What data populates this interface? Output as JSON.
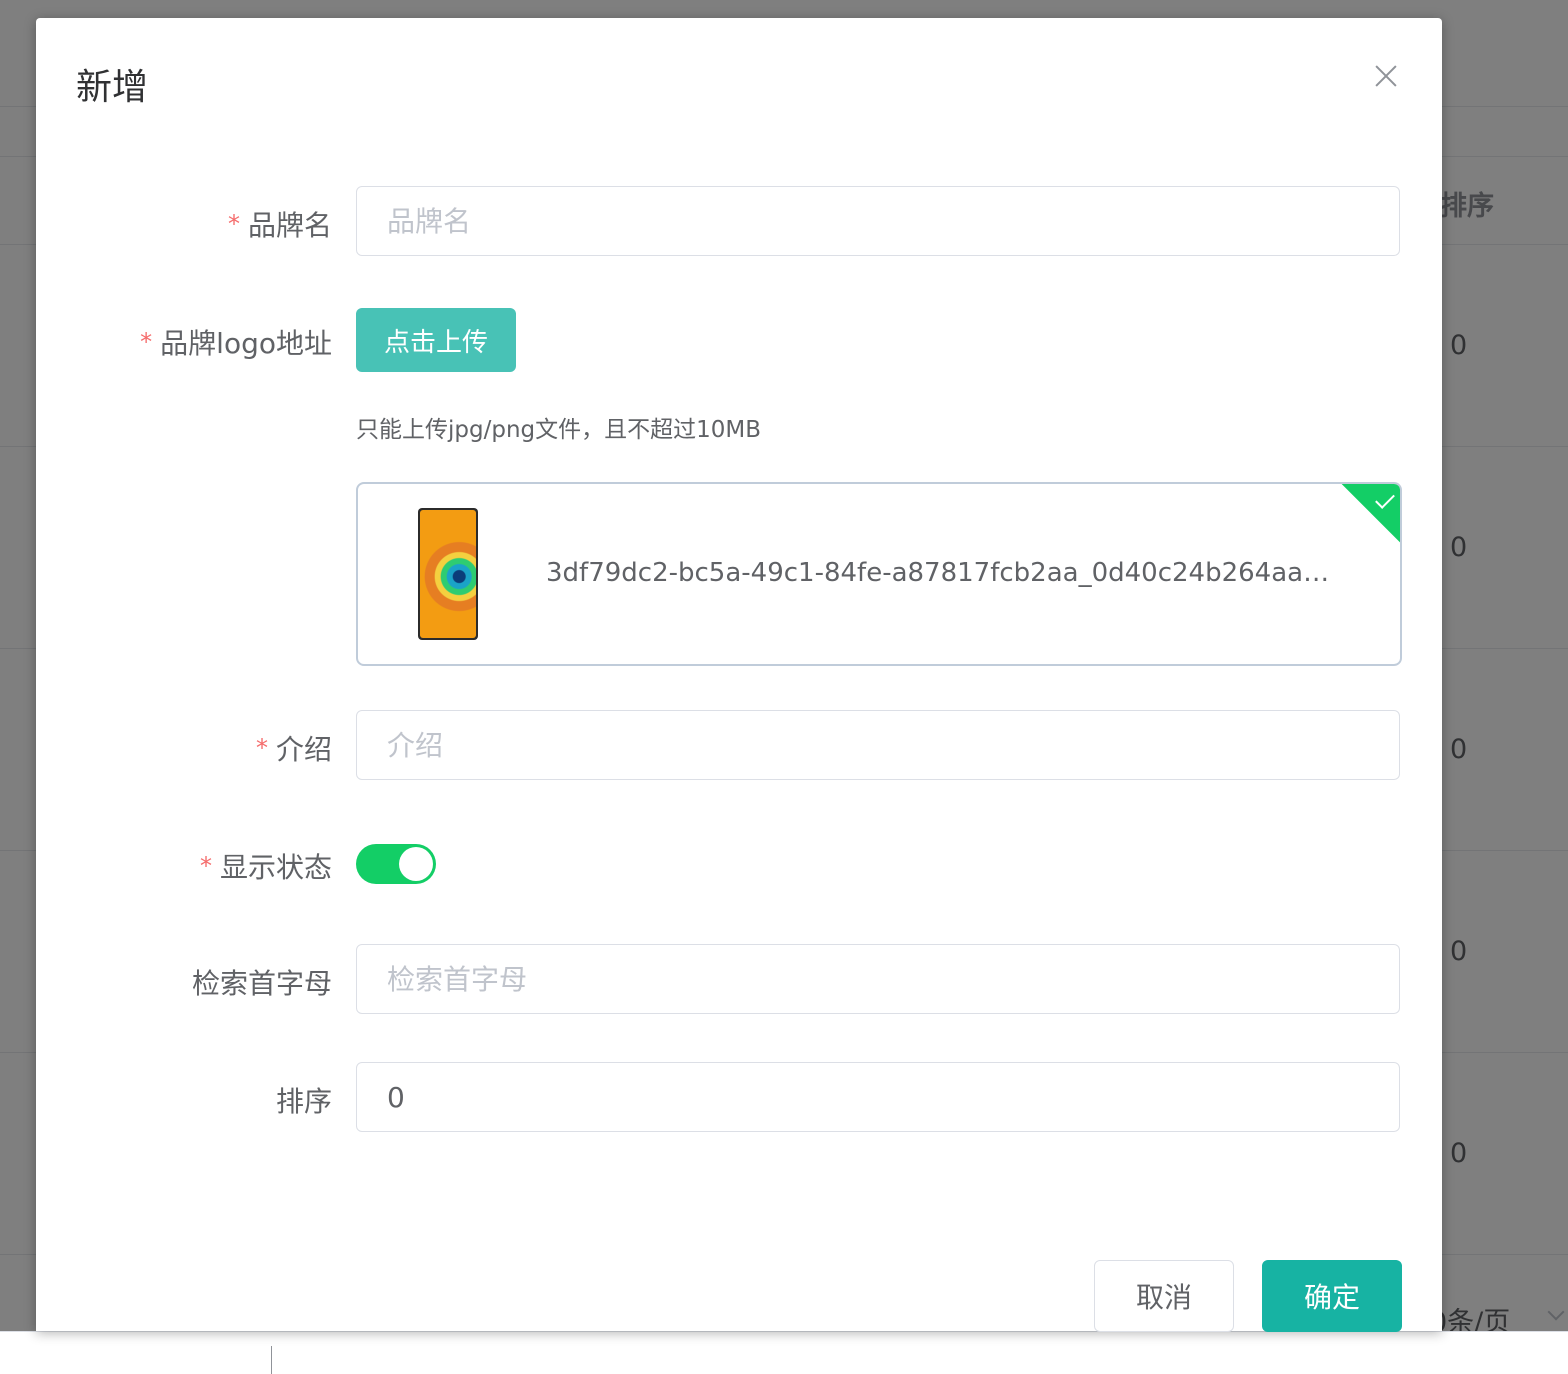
{
  "background": {
    "column_header": "排序",
    "row_values": [
      "0",
      "0",
      "0",
      "0",
      "0"
    ],
    "pagination_size": "0条/页"
  },
  "dialog": {
    "title": "新增",
    "fields": {
      "brand_name": {
        "label": "品牌名",
        "placeholder": "品牌名",
        "value": "",
        "required": true
      },
      "logo": {
        "label": "品牌logo地址",
        "required": true,
        "upload_button": "点击上传",
        "tip": "只能上传jpg/png文件，且不超过10MB",
        "file_name": "3df79dc2-bc5a-49c1-84fe-a87817fcb2aa_0d40c24b264aa…",
        "status": "success"
      },
      "description": {
        "label": "介绍",
        "placeholder": "介绍",
        "value": "",
        "required": true
      },
      "show_status": {
        "label": "显示状态",
        "required": true,
        "value": true
      },
      "first_letter": {
        "label": "检索首字母",
        "placeholder": "检索首字母",
        "value": "",
        "required": false
      },
      "sort": {
        "label": "排序",
        "placeholder": "",
        "value": "0",
        "required": false
      }
    },
    "buttons": {
      "cancel": "取消",
      "confirm": "确定"
    }
  },
  "colors": {
    "primary_button": "#17b3a3",
    "upload_button": "#48c2b6",
    "switch_on": "#13ce66",
    "required_mark": "#f56c6c"
  }
}
